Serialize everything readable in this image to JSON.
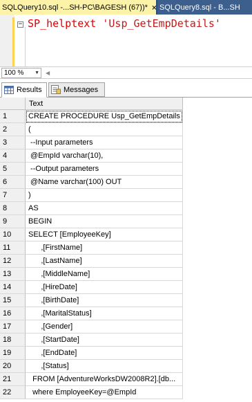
{
  "tabs": [
    {
      "label": "SQLQuery10.sql -...SH-PC\\BAGESH (67))*",
      "close": "×",
      "active": true
    },
    {
      "label": "SQLQuery8.sql - B...SH",
      "active": false
    }
  ],
  "editor": {
    "fold_symbol": "−",
    "keyword": "SP_helptext",
    "argument": "'Usp_GetEmpDetails'"
  },
  "zoom": {
    "value": "100 %"
  },
  "result_tabs": {
    "results": "Results",
    "messages": "Messages"
  },
  "grid": {
    "column": "Text",
    "rows": [
      {
        "n": "1",
        "text": "CREATE PROCEDURE Usp_GetEmpDetails"
      },
      {
        "n": "2",
        "text": "("
      },
      {
        "n": "3",
        "text": " --Input parameters"
      },
      {
        "n": "4",
        "text": " @EmpId varchar(10),"
      },
      {
        "n": "5",
        "text": " --Output parameters"
      },
      {
        "n": "6",
        "text": " @Name varchar(100) OUT"
      },
      {
        "n": "7",
        "text": ")"
      },
      {
        "n": "8",
        "text": "AS"
      },
      {
        "n": "9",
        "text": "BEGIN"
      },
      {
        "n": "10",
        "text": "SELECT [EmployeeKey]"
      },
      {
        "n": "11",
        "text": "      ,[FirstName]"
      },
      {
        "n": "12",
        "text": "      ,[LastName]"
      },
      {
        "n": "13",
        "text": "      ,[MiddleName]"
      },
      {
        "n": "14",
        "text": "      ,[HireDate]"
      },
      {
        "n": "15",
        "text": "      ,[BirthDate]"
      },
      {
        "n": "16",
        "text": "      ,[MaritalStatus]"
      },
      {
        "n": "17",
        "text": "      ,[Gender]"
      },
      {
        "n": "18",
        "text": "      ,[StartDate]"
      },
      {
        "n": "19",
        "text": "      ,[EndDate]"
      },
      {
        "n": "20",
        "text": "      ,[Status]"
      },
      {
        "n": "21",
        "text": "  FROM [AdventureWorksDW2008R2].[db..."
      },
      {
        "n": "22",
        "text": "  where EmployeeKey=@EmpId"
      }
    ]
  }
}
